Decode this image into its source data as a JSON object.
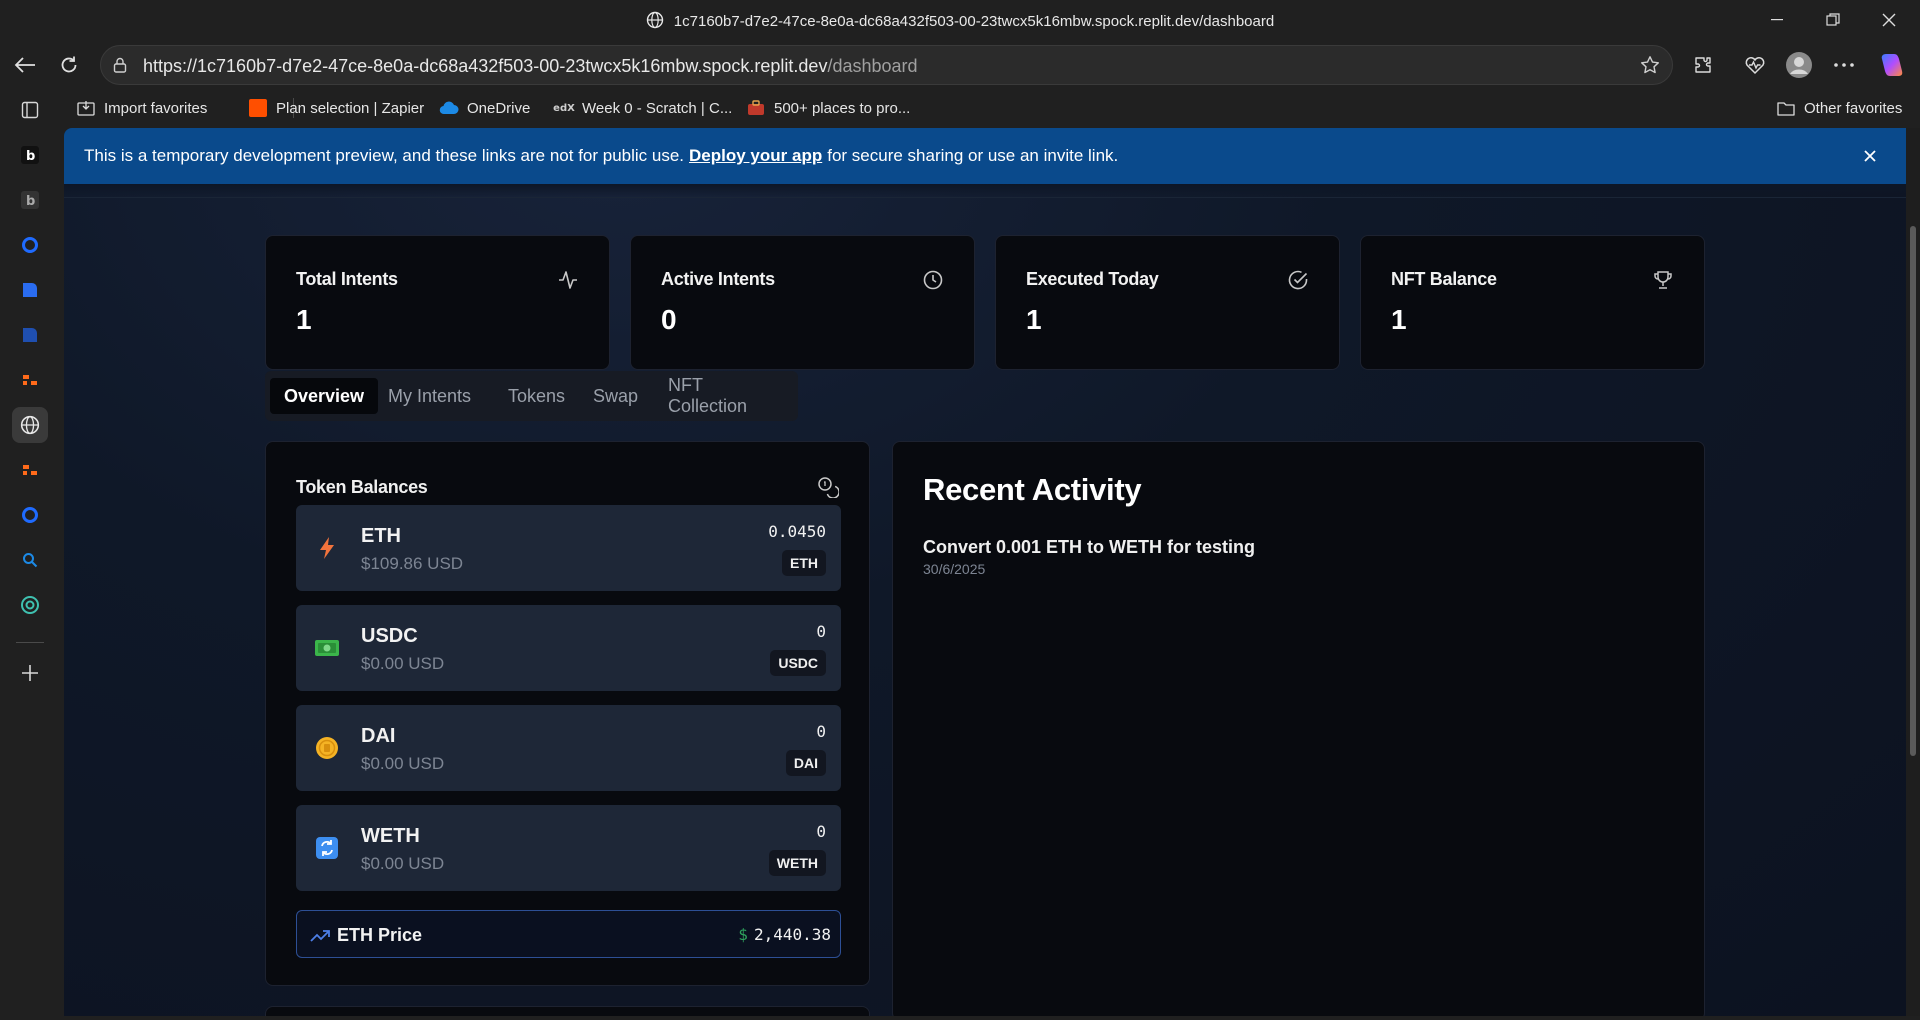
{
  "browser": {
    "window_title": "1c7160b7-d7e2-47ce-8e0a-dc68a432f503-00-23twcx5k16mbw.spock.replit.dev/dashboard",
    "url_host": "https://1c7160b7-d7e2-47ce-8e0a-dc68a432f503-00-23twcx5k16mbw.spock.replit.dev",
    "url_path": "/dashboard",
    "favorites": [
      {
        "label": "Import favorites",
        "icon": "import-icon"
      },
      {
        "label": "Plan selection | Zapier",
        "icon": "zapier-icon"
      },
      {
        "label": "OneDrive",
        "icon": "onedrive-icon"
      },
      {
        "label": "Week 0 - Scratch | C...",
        "icon": "edx-icon"
      },
      {
        "label": "500+ places to pro...",
        "icon": "briefcase-icon"
      }
    ],
    "other_favorites": "Other favorites",
    "accent_color": "#0a4a8c"
  },
  "banner": {
    "text_before": "This is a temporary development preview, and these links are not for public use.",
    "link": "Deploy your app",
    "text_after": "for secure sharing or use an invite link."
  },
  "stats": [
    {
      "label": "Total Intents",
      "value": "1",
      "icon": "activity-icon"
    },
    {
      "label": "Active Intents",
      "value": "0",
      "icon": "clock-icon"
    },
    {
      "label": "Executed Today",
      "value": "1",
      "icon": "check-circle-icon"
    },
    {
      "label": "NFT Balance",
      "value": "1",
      "icon": "trophy-icon"
    }
  ],
  "tabs": [
    "Overview",
    "My Intents",
    "Tokens",
    "Swap",
    "NFT Collection"
  ],
  "token_balances": {
    "title": "Token Balances",
    "tokens": [
      {
        "symbol": "ETH",
        "usd": "$109.86 USD",
        "amount": "0.0450",
        "badge": "ETH",
        "icon": "lightning-icon"
      },
      {
        "symbol": "USDC",
        "usd": "$0.00 USD",
        "amount": "0",
        "badge": "USDC",
        "icon": "cash-icon"
      },
      {
        "symbol": "DAI",
        "usd": "$0.00 USD",
        "amount": "0",
        "badge": "DAI",
        "icon": "coin-icon"
      },
      {
        "symbol": "WETH",
        "usd": "$0.00 USD",
        "amount": "0",
        "badge": "WETH",
        "icon": "swap-icon"
      }
    ],
    "eth_price": {
      "label": "ETH Price",
      "currency": "$",
      "value": "2,440.38"
    }
  },
  "recent_activity": {
    "title": "Recent Activity",
    "items": [
      {
        "title": "Convert 0.001 ETH to WETH for testing",
        "date": "30/6/2025"
      }
    ]
  }
}
